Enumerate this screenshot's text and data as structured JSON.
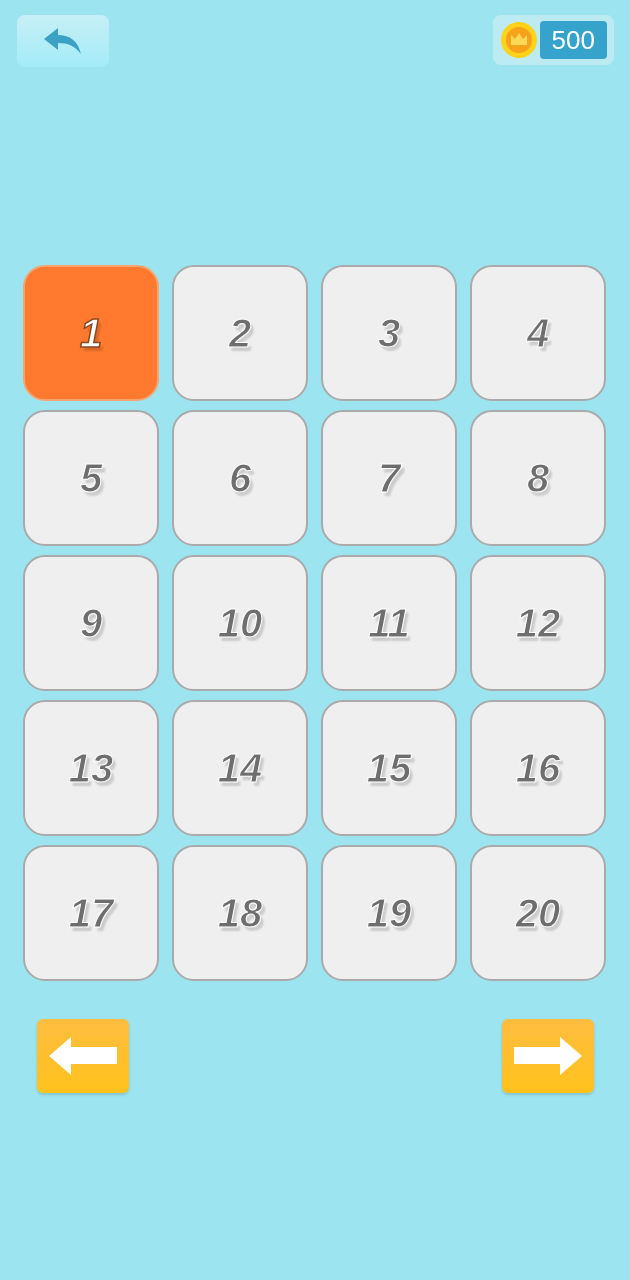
{
  "coins": "500",
  "levels": [
    {
      "label": "1",
      "selected": true
    },
    {
      "label": "2",
      "selected": false
    },
    {
      "label": "3",
      "selected": false
    },
    {
      "label": "4",
      "selected": false
    },
    {
      "label": "5",
      "selected": false
    },
    {
      "label": "6",
      "selected": false
    },
    {
      "label": "7",
      "selected": false
    },
    {
      "label": "8",
      "selected": false
    },
    {
      "label": "9",
      "selected": false
    },
    {
      "label": "10",
      "selected": false
    },
    {
      "label": "11",
      "selected": false
    },
    {
      "label": "12",
      "selected": false
    },
    {
      "label": "13",
      "selected": false
    },
    {
      "label": "14",
      "selected": false
    },
    {
      "label": "15",
      "selected": false
    },
    {
      "label": "16",
      "selected": false
    },
    {
      "label": "17",
      "selected": false
    },
    {
      "label": "18",
      "selected": false
    },
    {
      "label": "19",
      "selected": false
    },
    {
      "label": "20",
      "selected": false
    }
  ]
}
